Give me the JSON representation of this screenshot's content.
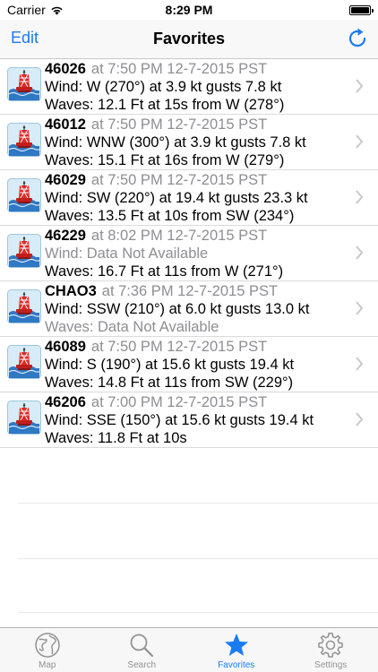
{
  "status": {
    "carrier": "Carrier",
    "time": "8:29 PM"
  },
  "nav": {
    "edit_label": "Edit",
    "title": "Favorites"
  },
  "stations": [
    {
      "id": "46026",
      "time": "at 7:50 PM 12-7-2015 PST",
      "wind": "Wind: W (270°) at 3.9 kt gusts 7.8 kt",
      "waves": "Waves: 12.1 Ft at 15s from W (278°)"
    },
    {
      "id": "46012",
      "time": "at 7:50 PM 12-7-2015 PST",
      "wind": "Wind: WNW (300°) at 3.9 kt gusts 7.8 kt",
      "waves": "Waves: 15.1 Ft at 16s from W (279°)"
    },
    {
      "id": "46029",
      "time": "at 7:50 PM 12-7-2015 PST",
      "wind": "Wind: SW (220°) at 19.4 kt gusts 23.3 kt",
      "waves": "Waves: 13.5 Ft at 10s from SW (234°)"
    },
    {
      "id": "46229",
      "time": "at 8:02 PM 12-7-2015 PST",
      "wind": "Wind: Data Not Available",
      "waves": "Waves: 16.7 Ft at 11s from W (271°)"
    },
    {
      "id": "CHAO3",
      "time": "at 7:36 PM 12-7-2015 PST",
      "wind": "Wind: SSW (210°) at 6.0 kt gusts 13.0 kt",
      "waves": "Waves: Data Not Available"
    },
    {
      "id": "46089",
      "time": "at 7:50 PM 12-7-2015 PST",
      "wind": "Wind: S (190°) at 15.6 kt gusts 19.4 kt",
      "waves": "Waves: 14.8 Ft at 11s from SW (229°)"
    },
    {
      "id": "46206",
      "time": "at 7:00 PM 12-7-2015 PST",
      "wind": "Wind: SSE (150°) at 15.6 kt gusts 19.4 kt",
      "waves": "Waves: 11.8 Ft at 10s"
    }
  ],
  "tabs": [
    {
      "label": "Map",
      "icon": "globe-icon"
    },
    {
      "label": "Search",
      "icon": "magnifier-icon"
    },
    {
      "label": "Favorites",
      "icon": "star-icon"
    },
    {
      "label": "Settings",
      "icon": "gear-icon"
    }
  ],
  "colors": {
    "accent": "#1a7cf2",
    "muted": "#8e8e93",
    "buoy_red": "#e02a26"
  }
}
